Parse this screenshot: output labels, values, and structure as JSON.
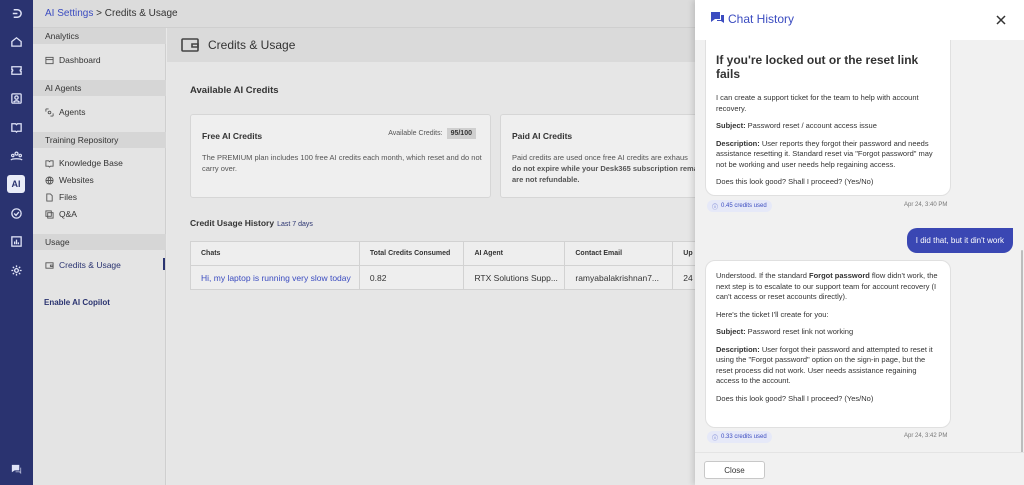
{
  "rail": {
    "icons": [
      "logo-icon",
      "home-icon",
      "ticket-icon",
      "contacts-icon",
      "knowledge-icon",
      "community-icon",
      "ai-icon",
      "check-icon",
      "reports-icon",
      "settings-icon",
      "chat-icon"
    ],
    "ai_label": "AI"
  },
  "breadcrumb": {
    "parent": "AI Settings",
    "separator": " > ",
    "current": "Credits & Usage"
  },
  "subnav": {
    "sections": [
      {
        "label": "Analytics",
        "items": [
          {
            "label": "Dashboard",
            "icon": "dashboard-icon"
          }
        ]
      },
      {
        "label": "AI Agents",
        "items": [
          {
            "label": "Agents",
            "icon": "agents-icon"
          }
        ]
      },
      {
        "label": "Training Repository",
        "items": [
          {
            "label": "Knowledge Base",
            "icon": "book-icon"
          },
          {
            "label": "Websites",
            "icon": "globe-icon"
          },
          {
            "label": "Files",
            "icon": "file-icon"
          },
          {
            "label": "Q&A",
            "icon": "qa-icon"
          }
        ]
      },
      {
        "label": "Usage",
        "items": [
          {
            "label": "Credits & Usage",
            "icon": "wallet-icon",
            "active": true
          }
        ]
      }
    ],
    "copilot": "Enable AI Copilot"
  },
  "main": {
    "title": "Credits & Usage",
    "available_heading": "Available AI Credits",
    "free_card": {
      "title": "Free AI Credits",
      "available_label": "Available Credits:",
      "available_value": "95/100",
      "text": "The PREMIUM plan includes 100 free AI credits each month, which reset and do not carry over."
    },
    "paid_card": {
      "title": "Paid AI Credits",
      "text_a": "Paid credits are used once free AI credits are exhaus",
      "text_b": "do not expire while your Desk365 subscription remai",
      "text_c": "are not refundable."
    },
    "history_heading": "Credit Usage History",
    "history_range": "Last 7 days",
    "table": {
      "headers": [
        "Chats",
        "Total Credits Consumed",
        "AI Agent",
        "Contact Email",
        "Up"
      ],
      "rows": [
        [
          "Hi, my laptop is running very slow today",
          "0.82",
          "RTX Solutions Supp...",
          "ramyabalakrishnan7...",
          "24"
        ]
      ]
    }
  },
  "drawer": {
    "title": "Chat History",
    "msg1": {
      "heading": "If you're locked out or the reset link fails",
      "intro": "I can create a support ticket for the team to help with account recovery.",
      "subject_label": "Subject:",
      "subject": " Password reset / account access issue",
      "desc_label": "Description:",
      "desc": " User reports they forgot their password and needs assistance resetting it. Standard reset via \"Forgot password\" may not be working and user needs help regaining access.",
      "confirm": "Does this look good? Shall I proceed? (Yes/No)",
      "credits": "0.45 credits used",
      "time": "Apr 24, 3:40 PM"
    },
    "user_msg": "I did that, but it din't work",
    "msg2": {
      "p1_a": "Understood. If the standard ",
      "p1_bold": "Forgot password",
      "p1_b": " flow didn't work, the next step is to escalate to our support team for account recovery (I can't access or reset accounts directly).",
      "p2": "Here's the ticket I'll create for you:",
      "subject_label": "Subject:",
      "subject": " Password reset link not working",
      "desc_label": "Description:",
      "desc": " User forgot their password and attempted to reset it using the \"Forgot password\" option on the sign-in page, but the reset process did not work. User needs assistance regaining access to the account.",
      "confirm": "Does this look good? Shall I proceed? (Yes/No)",
      "credits": "0.33 credits used",
      "time": "Apr 24, 3:42 PM"
    },
    "close_label": "Close"
  },
  "colors": {
    "rail": "#2a3370",
    "accent": "#3b4cc0",
    "user_bubble": "#3a47b3"
  }
}
